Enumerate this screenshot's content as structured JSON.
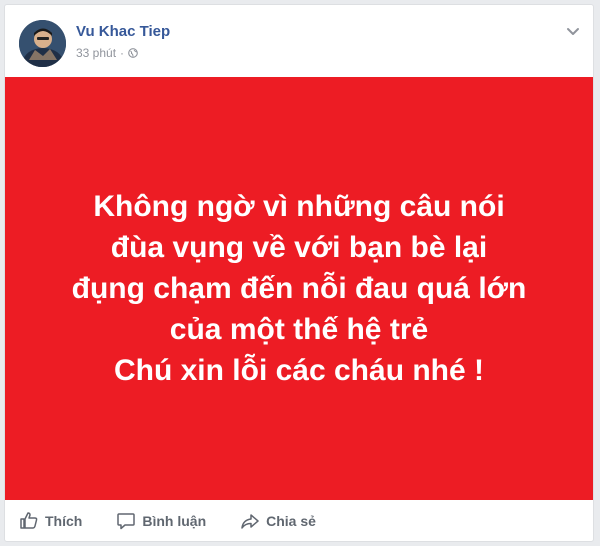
{
  "post": {
    "author": "Vu Khac Tiep",
    "time": "33 phút",
    "separator": "·",
    "privacy_icon": "globe-icon",
    "menu_icon": "chevron-down-icon",
    "image": {
      "background": "#ed1c24",
      "lines": [
        "Không ngờ vì những câu nói",
        "đùa vụng về với bạn bè lại",
        "đụng chạm đến nỗi đau quá lớn",
        "của một thế hệ trẻ",
        "Chú xin lỗi các cháu nhé !"
      ]
    }
  },
  "actions": {
    "like": "Thích",
    "comment": "Bình luận",
    "share": "Chia sẻ"
  },
  "colors": {
    "author_link": "#365899",
    "meta_text": "#90949c",
    "action_text": "#606770"
  }
}
